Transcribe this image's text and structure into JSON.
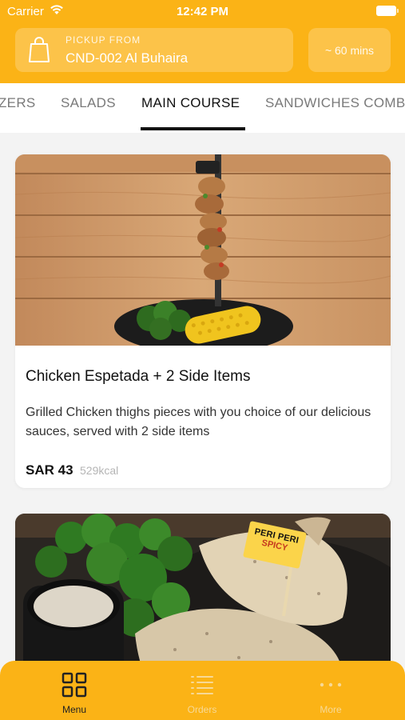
{
  "status_bar": {
    "carrier": "Carrier",
    "time": "12:42 PM"
  },
  "header": {
    "pickup_label": "PICKUP FROM",
    "pickup_location": "CND-002 Al Buhaira",
    "time_estimate": "~ 60 mins",
    "accent_color": "#fbb316"
  },
  "tabs": [
    {
      "label": "ZERS",
      "active": false
    },
    {
      "label": "SALADS",
      "active": false
    },
    {
      "label": "MAIN COURSE",
      "active": true
    },
    {
      "label": "SANDWICHES COMB",
      "active": false
    }
  ],
  "items": [
    {
      "title": "Chicken Espetada + 2 Side Items",
      "description": "Grilled Chicken thighs pieces with you choice of our delicious sauces, served with 2 side items",
      "price": "SAR 43",
      "calories": "529kcal"
    },
    {
      "flag_line1": "PERI PERI",
      "flag_line2": "SPICY"
    }
  ],
  "bottom_nav": [
    {
      "label": "Menu",
      "icon": "grid-icon",
      "active": true
    },
    {
      "label": "Orders",
      "icon": "list-icon",
      "active": false
    },
    {
      "label": "More",
      "icon": "dots-icon",
      "active": false
    }
  ]
}
